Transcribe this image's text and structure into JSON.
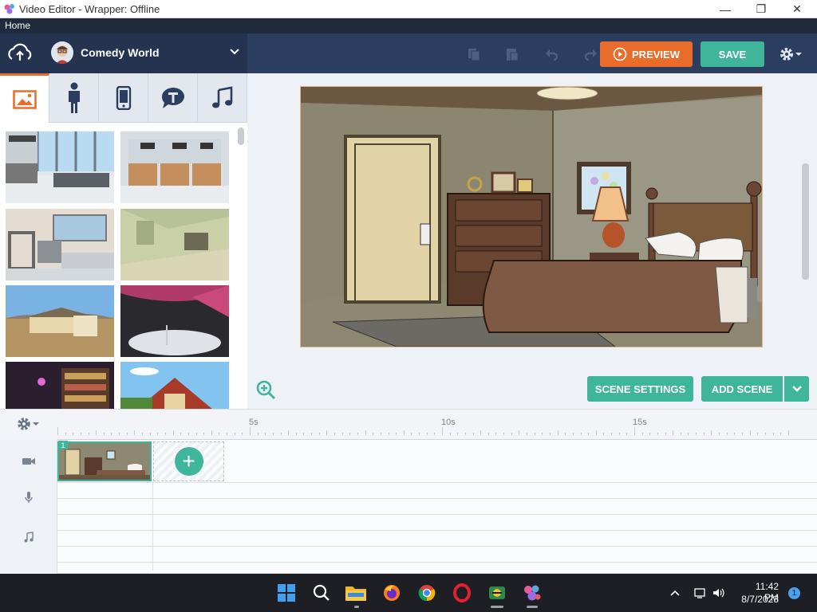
{
  "window": {
    "title": "Video Editor - Wrapper: Offline"
  },
  "menu": {
    "home": "Home"
  },
  "header": {
    "theme_name": "Comedy World",
    "preview_label": "PREVIEW",
    "save_label": "SAVE"
  },
  "asset_tabs": [
    "background-icon",
    "character-icon",
    "prop-icon",
    "text-icon",
    "music-icon"
  ],
  "asset_thumbs": [
    "airport-lobby",
    "airport-counter",
    "security-checkpoint",
    "tent-interior",
    "desert-house",
    "stage",
    "store-shelves",
    "house-roof"
  ],
  "stage": {
    "scene_settings_label": "SCENE SETTINGS",
    "add_scene_label": "ADD SCENE"
  },
  "timeline": {
    "ticks": [
      "5s",
      "10s",
      "15s"
    ],
    "scene_number": "1",
    "tracks": [
      "video-icon",
      "mic-icon",
      "music-note-icon"
    ]
  },
  "taskbar": {
    "time": "11:42 PM",
    "date": "8/7/2023",
    "notification_count": "1"
  },
  "colors": {
    "accent_orange": "#e96c2a",
    "accent_green": "#3fb59a",
    "header_bg": "#2c3e5f"
  }
}
